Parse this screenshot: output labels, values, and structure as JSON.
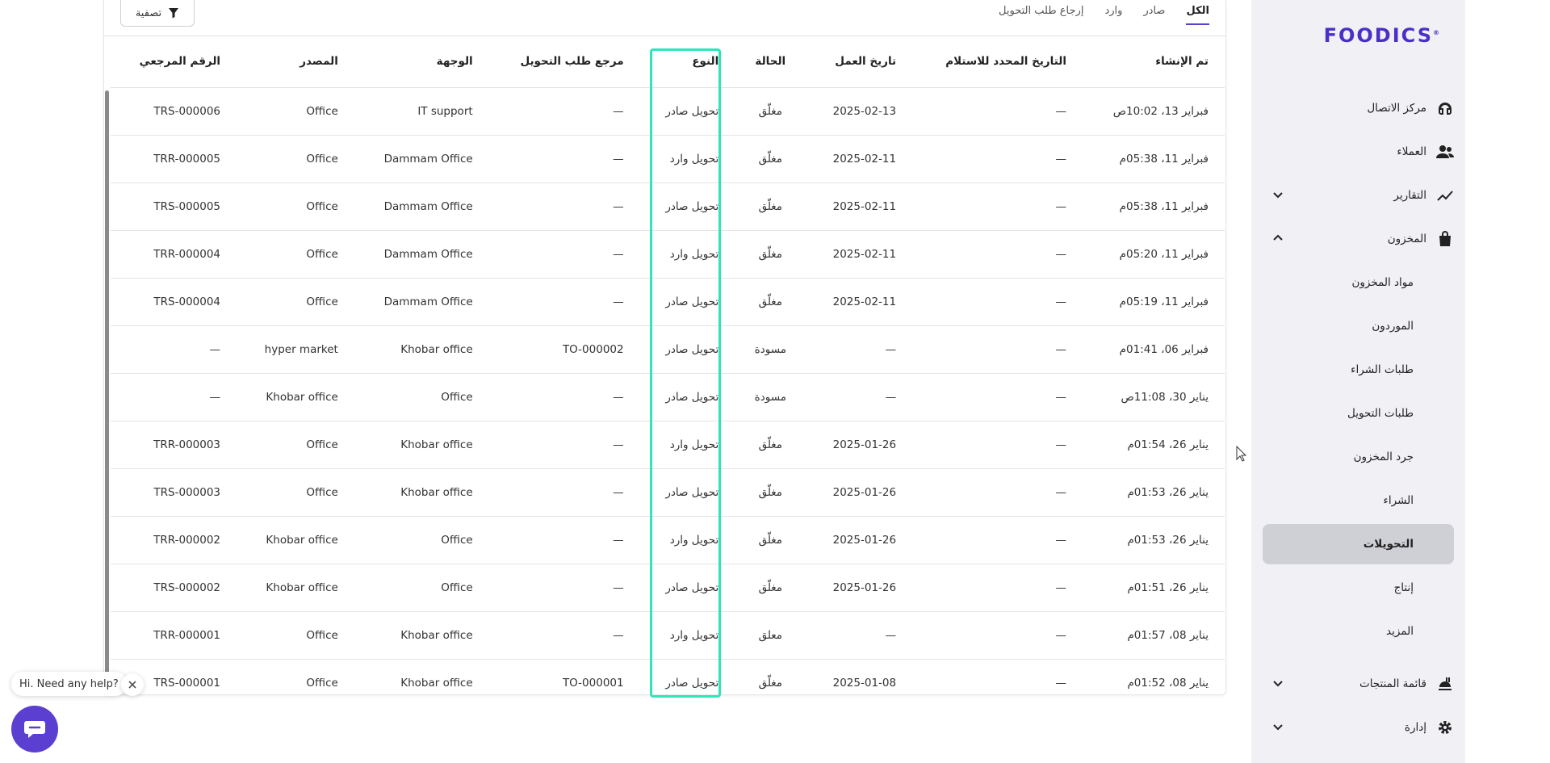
{
  "brand": {
    "logo_text": "FOODICS",
    "accent": "#5b3fd1",
    "highlight": "#2ee6b8"
  },
  "tabs": [
    {
      "label": "الكل",
      "active": true
    },
    {
      "label": "صادر",
      "active": false
    },
    {
      "label": "وارد",
      "active": false
    },
    {
      "label": "إرجاع طلب التحويل",
      "active": false
    }
  ],
  "filter": {
    "label": "تصفية",
    "icon": "filter-icon"
  },
  "table": {
    "headers": {
      "ref": "الرقم المرجعي",
      "source": "المصدر",
      "dest": "الوجهة",
      "transfer_ref": "مرجع طلب التحويل",
      "type": "النوع",
      "status": "الحالة",
      "business_date": "تاريخ العمل",
      "due_date": "التاريخ المحدد للاستلام",
      "created": "تم الإنشاء"
    },
    "rows": [
      {
        "ref": "TRS-000006",
        "source": "Office",
        "dest": "IT support",
        "transfer_ref": "—",
        "type": "تحويل صادر",
        "status": "مغلّق",
        "business_date": "2025-02-13",
        "due_date": "—",
        "created": "فبراير 13، 10:02ص"
      },
      {
        "ref": "TRR-000005",
        "source": "Office",
        "dest": "Dammam Office",
        "transfer_ref": "—",
        "type": "تحويل وارد",
        "status": "مغلّق",
        "business_date": "2025-02-11",
        "due_date": "—",
        "created": "فبراير 11، 05:38م"
      },
      {
        "ref": "TRS-000005",
        "source": "Office",
        "dest": "Dammam Office",
        "transfer_ref": "—",
        "type": "تحويل صادر",
        "status": "مغلّق",
        "business_date": "2025-02-11",
        "due_date": "—",
        "created": "فبراير 11، 05:38م"
      },
      {
        "ref": "TRR-000004",
        "source": "Office",
        "dest": "Dammam Office",
        "transfer_ref": "—",
        "type": "تحويل وارد",
        "status": "مغلّق",
        "business_date": "2025-02-11",
        "due_date": "—",
        "created": "فبراير 11، 05:20م"
      },
      {
        "ref": "TRS-000004",
        "source": "Office",
        "dest": "Dammam Office",
        "transfer_ref": "—",
        "type": "تحويل صادر",
        "status": "مغلّق",
        "business_date": "2025-02-11",
        "due_date": "—",
        "created": "فبراير 11، 05:19م"
      },
      {
        "ref": "—",
        "source": "hyper market",
        "dest": "Khobar office",
        "transfer_ref": "TO-000002",
        "type": "تحويل صادر",
        "status": "مسودة",
        "business_date": "—",
        "due_date": "—",
        "created": "فبراير 06، 01:41م"
      },
      {
        "ref": "—",
        "source": "Khobar office",
        "dest": "Office",
        "transfer_ref": "—",
        "type": "تحويل صادر",
        "status": "مسودة",
        "business_date": "—",
        "due_date": "—",
        "created": "يناير 30، 11:08ص"
      },
      {
        "ref": "TRR-000003",
        "source": "Office",
        "dest": "Khobar office",
        "transfer_ref": "—",
        "type": "تحويل وارد",
        "status": "مغلّق",
        "business_date": "2025-01-26",
        "due_date": "—",
        "created": "يناير 26، 01:54م"
      },
      {
        "ref": "TRS-000003",
        "source": "Office",
        "dest": "Khobar office",
        "transfer_ref": "—",
        "type": "تحويل صادر",
        "status": "مغلّق",
        "business_date": "2025-01-26",
        "due_date": "—",
        "created": "يناير 26، 01:53م"
      },
      {
        "ref": "TRR-000002",
        "source": "Khobar office",
        "dest": "Office",
        "transfer_ref": "—",
        "type": "تحويل وارد",
        "status": "مغلّق",
        "business_date": "2025-01-26",
        "due_date": "—",
        "created": "يناير 26، 01:53م"
      },
      {
        "ref": "TRS-000002",
        "source": "Khobar office",
        "dest": "Office",
        "transfer_ref": "—",
        "type": "تحويل صادر",
        "status": "مغلّق",
        "business_date": "2025-01-26",
        "due_date": "—",
        "created": "يناير 26، 01:51م"
      },
      {
        "ref": "TRR-000001",
        "source": "Office",
        "dest": "Khobar office",
        "transfer_ref": "—",
        "type": "تحويل وارد",
        "status": "معلق",
        "business_date": "—",
        "due_date": "—",
        "created": "يناير 08، 01:57م"
      },
      {
        "ref": "TRS-000001",
        "source": "Office",
        "dest": "Khobar office",
        "transfer_ref": "TO-000001",
        "type": "تحويل صادر",
        "status": "مغلّق",
        "business_date": "2025-01-08",
        "due_date": "—",
        "created": "يناير 08، 01:52م"
      }
    ]
  },
  "sidebar": {
    "items": [
      {
        "label": "مركز الاتصال",
        "icon": "headset-icon",
        "chevron": ""
      },
      {
        "label": "العملاء",
        "icon": "users-icon",
        "chevron": ""
      },
      {
        "label": "التقارير",
        "icon": "chart-line-icon",
        "chevron": "down"
      },
      {
        "label": "المخزون",
        "icon": "bag-icon",
        "chevron": "up"
      }
    ],
    "inventory_sub": [
      {
        "label": "مواد المخزون",
        "active": false
      },
      {
        "label": "الموردون",
        "active": false
      },
      {
        "label": "طلبات الشراء",
        "active": false
      },
      {
        "label": "طلبات التحويل",
        "active": false
      },
      {
        "label": "جرد المخزون",
        "active": false
      },
      {
        "label": "الشراء",
        "active": false
      },
      {
        "label": "التحويلات",
        "active": true
      },
      {
        "label": "إنتاج",
        "active": false
      },
      {
        "label": "المزيد",
        "active": false
      }
    ],
    "bottom_items": [
      {
        "label": "قائمة المنتجات",
        "icon": "menu-food-icon",
        "chevron": "down"
      },
      {
        "label": "إدارة",
        "icon": "gear-icon",
        "chevron": "down"
      }
    ]
  },
  "help": {
    "bubble_text": "Hi. Need any help?"
  }
}
